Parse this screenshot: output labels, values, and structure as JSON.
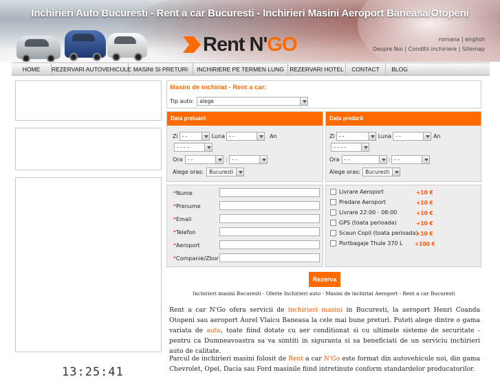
{
  "header": {
    "title": "Inchirieri Auto Bucuresti - Rent a car Bucuresti - Inchirieri Masini Aeroport Baneasa/Otopeni",
    "logo_main": "Rent N'",
    "logo_accent": "GO",
    "lang_ro": "romana",
    "lang_en": "english",
    "link_about": "Despre Noi",
    "link_conditions": "Conditii inchiriere",
    "link_sitemap": "Sitemap"
  },
  "nav": {
    "items": [
      "HOME",
      "REZERVARI AUTOVEHICULE",
      "MASINI SI PRETURI",
      "INCHIRIERE PE TERMEN LUNG",
      "REZERVARI HOTEL",
      "CONTACT",
      "BLOG"
    ]
  },
  "clock": "13:25:41",
  "form": {
    "title": "Masini de inchiriat - Rent a car:",
    "tip_label": "Tip auto:",
    "tip_value": "alege",
    "pickup": {
      "heading": "Data preluarii",
      "zi_label": "Zi",
      "luna_label": "Luna",
      "an_label": "An",
      "ora_label": "Ora",
      "day_value": "- -",
      "month_value": "- -",
      "year_value": "- - - -",
      "hour_value": "- -",
      "minute_value": "- -",
      "colon": ":",
      "city_label": "Alege oras:",
      "city_value": "Bucuresti"
    },
    "dropoff": {
      "heading": "Data predarii",
      "zi_label": "Zi",
      "luna_label": "Luna",
      "an_label": "An",
      "ora_label": "Ora",
      "day_value": "- -",
      "month_value": "- -",
      "year_value": "- - - -",
      "hour_value": "- -",
      "minute_value": "- -",
      "colon": ":",
      "city_label": "Alege oras:",
      "city_value": "Bucuresti"
    },
    "contact_fields": [
      {
        "label": "Nume"
      },
      {
        "label": "Prenume"
      },
      {
        "label": "Email"
      },
      {
        "label": "Telefon"
      },
      {
        "label": "Aeroport"
      },
      {
        "label": "Companie/Zbor"
      }
    ],
    "extras": [
      {
        "label": "Livrare Aeroport",
        "price": "+10 €"
      },
      {
        "label": "Predare Aeroport",
        "price": "+10 €"
      },
      {
        "label": "Livrare 22:00 - 08:00",
        "price": "+10 €"
      },
      {
        "label": "GPS (toata perioada)",
        "price": "+10 €"
      },
      {
        "label": "Scaun Copil (toata perioada)",
        "price": "+10 €"
      },
      {
        "label": "Portbagaje Thule 370 L",
        "price": "+100 €"
      }
    ],
    "submit_label": "Rezerva"
  },
  "content": {
    "sub_links": "Inchirieri masini Bucuresti - Oferte Inchirieri auto - Masini de inchiriat Aeroport - Rent a car Bucuresti",
    "p1": {
      "t1": "Rent a car N'Go ofera servicii de ",
      "link1": "inchirieri masini",
      "t2": " in Bucuresti, la aeroport Henri Coanda Otopeni sau aeroport Aurel Vlaicu Baneasa la cele mai bune preturi. Puteti alege dintre o gama variata de ",
      "link2": "auto",
      "t3": ", toate fiind dotate cu aer conditionat si cu ultimele sisteme de securitate - pentru ca Dumneavoastra sa va simtiti in siguranta si sa beneficiati de un serviciu inchirieri auto de calitate."
    },
    "p2": {
      "t1": "Parcul de inchirieri masini folosit de ",
      "link1": "Rent",
      "t2": " a car ",
      "link2": "N'Go",
      "t3": " este format din autovehicule noi, din gama Chevrolet, Opel, Dacia sau Ford masinile fiind intretinute conform standardelor producatorilor."
    }
  },
  "colors": {
    "accent": "#ff6a00",
    "link": "#ff5500"
  }
}
